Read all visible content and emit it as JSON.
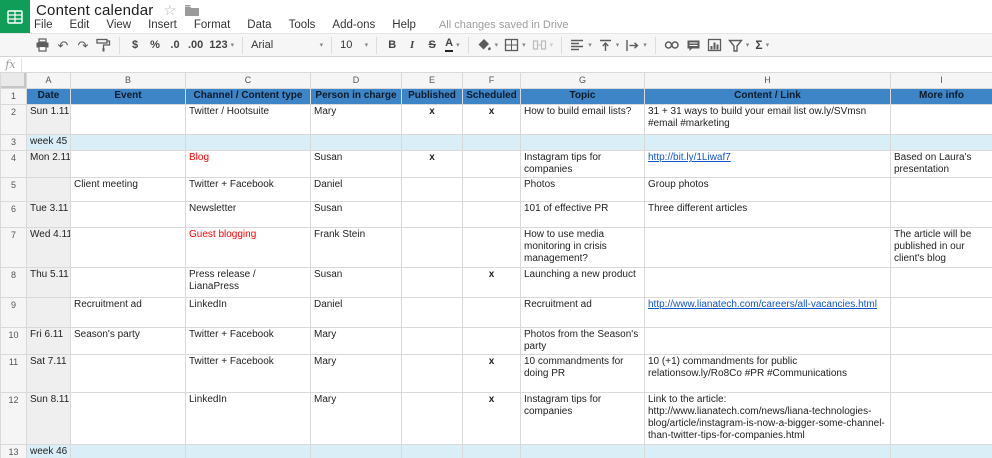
{
  "app": {
    "title": "Content calendar",
    "saved_status": "All changes saved in Drive",
    "menu": [
      "File",
      "Edit",
      "View",
      "Insert",
      "Format",
      "Data",
      "Tools",
      "Add-ons",
      "Help"
    ],
    "icons": {
      "undo": "↶",
      "redo": "↷",
      "dropdown": "▾",
      "star": "☆",
      "sigma": "Σ"
    },
    "toolbar_labels": {
      "currency": "$",
      "percent": "%",
      "dec_less": ".0",
      "dec_more": ".00",
      "format_123": "123",
      "font": "Arial",
      "size": "10",
      "bold": "B",
      "italic": "I",
      "strikethrough": "S",
      "text_color": "A"
    },
    "formula_bar_label": "fx"
  },
  "colors": {
    "header_blue": "#3d85c6",
    "week_blue": "#d9eef7",
    "alert_red": "#ff0000",
    "link_blue": "#1155cc",
    "logo_green": "#0f9d58",
    "date_col_gray": "#efefef"
  },
  "sheet": {
    "column_letters": [
      "A",
      "B",
      "C",
      "D",
      "E",
      "F",
      "G",
      "H",
      "I"
    ],
    "header_row": [
      "Date",
      "Event",
      "Channel / Content type",
      "Person in charge",
      "Published",
      "Scheduled",
      "Topic",
      "Content / Link",
      "More info"
    ],
    "rows": [
      {
        "num": 2,
        "kind": "data",
        "date": "Sun 1.11",
        "event": "",
        "channel": "Twitter / Hootsuite",
        "person": "Mary",
        "published": "x",
        "scheduled": "x",
        "topic": "How to build email lists?",
        "content": "31 + 31 ways to build your email list ow.ly/SVmsn #email #marketing",
        "more": ""
      },
      {
        "num": 3,
        "kind": "week",
        "label": "week 45"
      },
      {
        "num": 4,
        "kind": "data",
        "date": "Mon 2.11",
        "event": "",
        "channel": "Blog",
        "channel_red": true,
        "person": "Susan",
        "published": "x",
        "scheduled": "",
        "topic": "Instagram tips for companies",
        "content": "http://bit.ly/1Liwaf7",
        "content_is_link": true,
        "more": "Based on Laura's presentation"
      },
      {
        "num": 5,
        "kind": "data",
        "date": "",
        "event": "Client meeting",
        "channel": "Twitter + Facebook",
        "person": "Daniel",
        "published": "",
        "scheduled": "",
        "topic": "Photos",
        "content": "Group photos",
        "more": ""
      },
      {
        "num": 6,
        "kind": "data",
        "date": "Tue 3.11",
        "event": "",
        "channel": "Newsletter",
        "person": "Susan",
        "published": "",
        "scheduled": "",
        "topic": "101 of effective PR",
        "content": "Three different articles",
        "more": ""
      },
      {
        "num": 7,
        "kind": "data",
        "date": "Wed 4.11",
        "event": "",
        "channel": "Guest blogging",
        "channel_red": true,
        "person": "Frank Stein",
        "published": "",
        "scheduled": "",
        "topic": "How to use media monitoring in crisis management?",
        "content": "",
        "more": "The article will be published in our client's blog"
      },
      {
        "num": 8,
        "kind": "data",
        "date": "Thu 5.11",
        "event": "",
        "channel": "Press release / LianaPress",
        "person": "Susan",
        "published": "",
        "scheduled": "x",
        "topic": "Launching a new product",
        "content": "",
        "more": ""
      },
      {
        "num": 9,
        "kind": "data",
        "date": "",
        "event": "Recruitment ad",
        "channel": "LinkedIn",
        "person": "Daniel",
        "published": "",
        "scheduled": "",
        "topic": "Recruitment ad",
        "content": "http://www.lianatech.com/careers/all-vacancies.html",
        "content_is_link": true,
        "more": ""
      },
      {
        "num": 10,
        "kind": "data",
        "date": "Fri 6.11",
        "event": "Season's party",
        "channel": "Twitter + Facebook",
        "person": "Mary",
        "published": "",
        "scheduled": "",
        "topic": "Photos from the Season's party",
        "content": "",
        "more": ""
      },
      {
        "num": 11,
        "kind": "data",
        "date": "Sat 7.11",
        "event": "",
        "channel": "Twitter + Facebook",
        "person": "Mary",
        "published": "",
        "scheduled": "x",
        "topic": "10 commandments for doing PR",
        "content": "10 (+1) commandments for public relationsow.ly/Ro8Co #PR #Communications",
        "more": ""
      },
      {
        "num": 12,
        "kind": "data",
        "date": "Sun 8.11",
        "event": "",
        "channel": "LinkedIn",
        "person": "Mary",
        "published": "",
        "scheduled": "x",
        "topic": "Instagram tips for companies",
        "content": "Link to the article:\nhttp://www.lianatech.com/news/liana-technologies-blog/article/instagram-is-now-a-bigger-some-channel-than-twitter-tips-for-companies.html",
        "more": ""
      },
      {
        "num": 13,
        "kind": "week",
        "label": "week 46"
      }
    ]
  }
}
